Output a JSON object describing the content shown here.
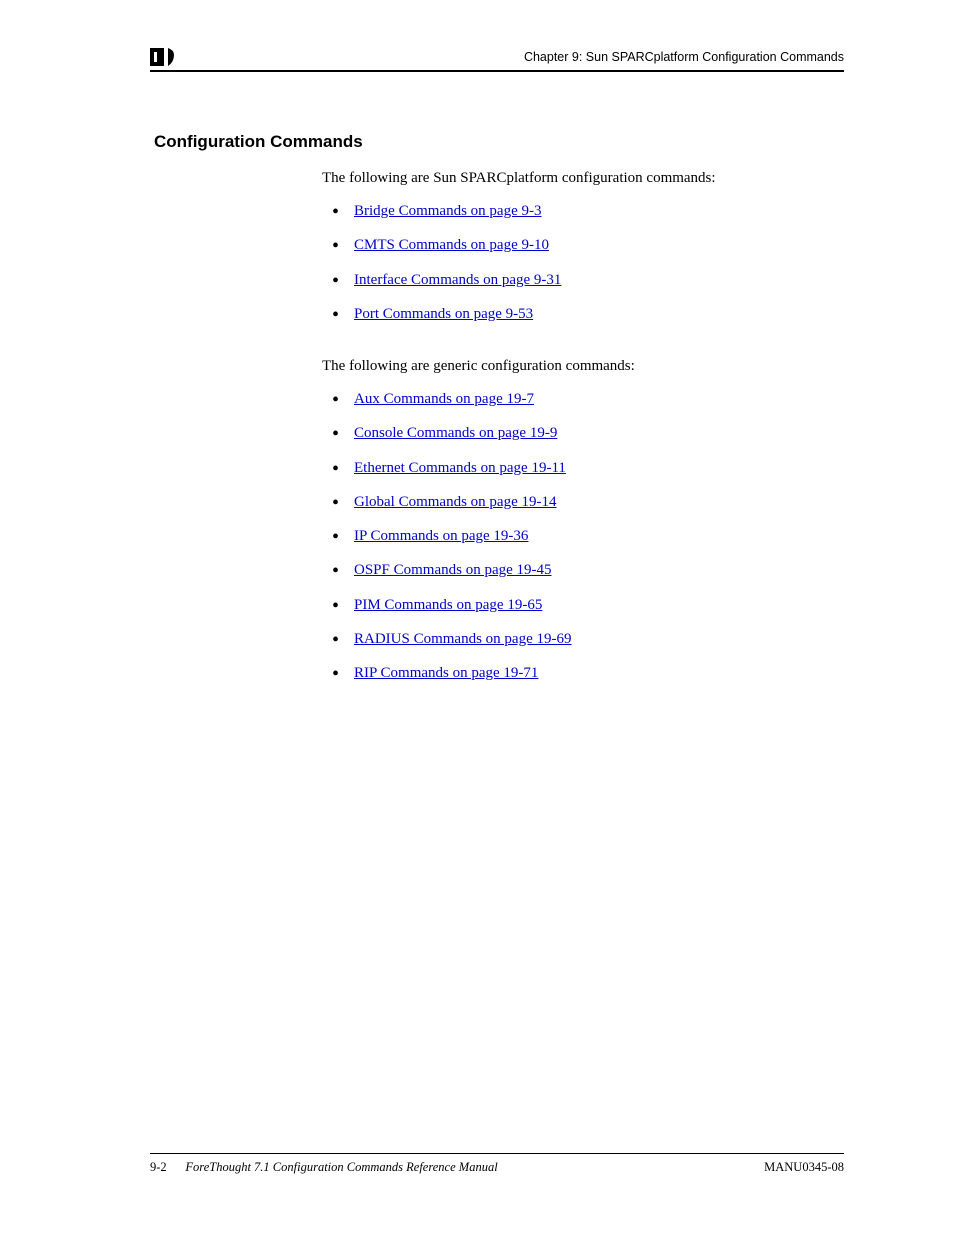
{
  "header": {
    "breadcrumb": "Chapter 9: Sun SPARCplatform Configuration Commands"
  },
  "page": {
    "heading": "Configuration Commands",
    "intro1": "The following are Sun SPARCplatform configuration commands:",
    "links1": [
      "Bridge Commands",
      "CMTS Commands",
      "Interface Commands",
      "Port Commands"
    ],
    "intro2": "The following are generic configuration commands:",
    "links2": [
      "Aux Commands",
      "Console Commands",
      "Ethernet Commands",
      "Global Commands",
      "IP Commands",
      "OSPF Commands",
      "PIM Commands",
      "RADIUS Commands",
      "RIP Commands"
    ]
  },
  "links1_refs": [
    "on page 9-3",
    "on page 9-10",
    "on page 9-31",
    "on page 9-53"
  ],
  "links2_refs": [
    "on page 19-7",
    "on page 19-9",
    "on page 19-11",
    "on page 19-14",
    "on page 19-36",
    "on page 19-45",
    "on page 19-65",
    "on page 19-69",
    "on page 19-71"
  ],
  "footer": {
    "label": "9-2",
    "title": "ForeThought 7.1 Configuration Commands Reference Manual",
    "ref": "MANU0345-08"
  }
}
